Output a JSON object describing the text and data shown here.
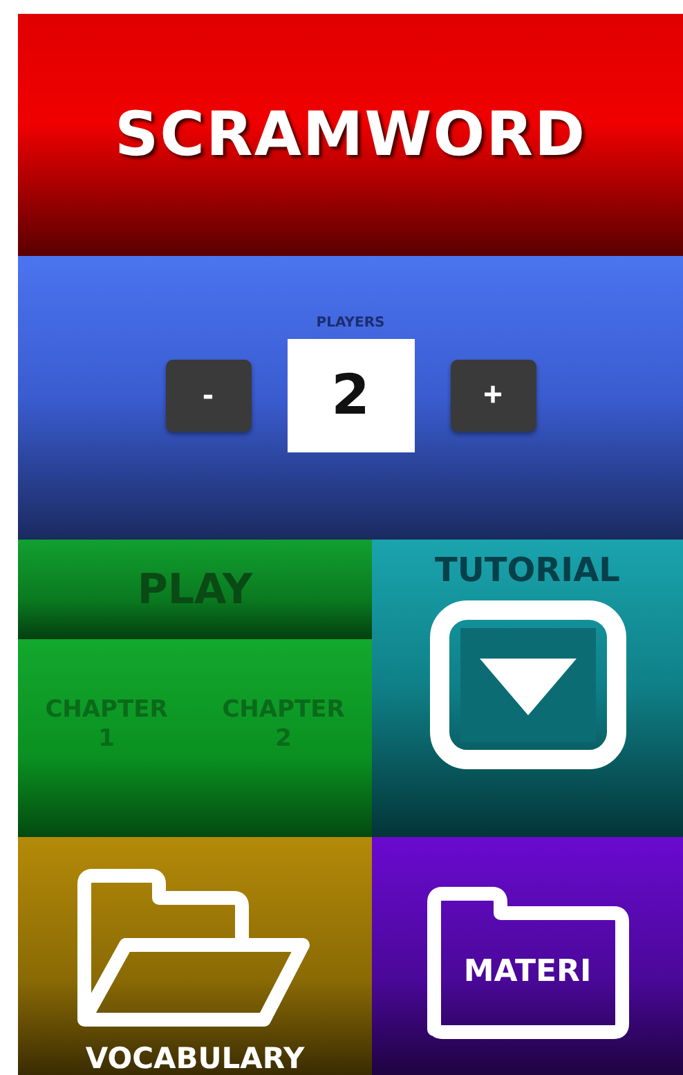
{
  "header": {
    "title": "SCRAMWORD"
  },
  "players": {
    "label": "PLAYERS",
    "decrement": "-",
    "value": "2",
    "increment": "+"
  },
  "play": {
    "title": "PLAY",
    "chapters": [
      "CHAPTER 1",
      "CHAPTER 2"
    ]
  },
  "tutorial": {
    "title": "TUTORIAL"
  },
  "vocabulary": {
    "title": "VOCABULARY"
  },
  "materi": {
    "title": "MATERI"
  }
}
